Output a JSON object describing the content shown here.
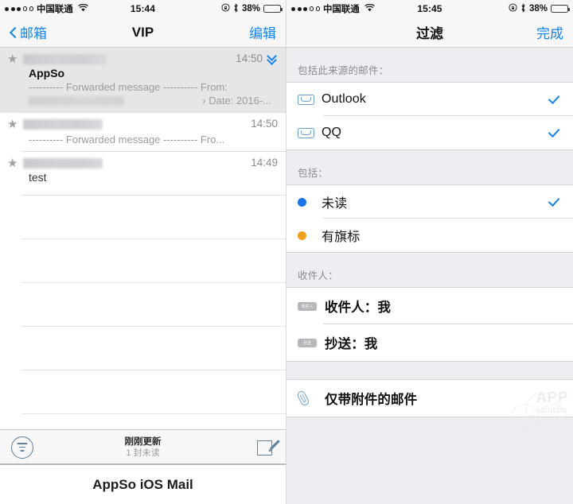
{
  "left": {
    "status": {
      "carrier": "中国联通",
      "time": "15:44",
      "battery_pct": "38%",
      "signal_dots_filled": 3,
      "signal_dots_total": 5
    },
    "nav": {
      "back_label": "邮箱",
      "title": "VIP",
      "right_label": "编辑"
    },
    "mails": [
      {
        "sender_blurred": true,
        "time": "14:50",
        "has_thread_chevron": true,
        "subject": "AppSo",
        "preview": "---------- Forwarded message ---------- From:",
        "preview2": "› Date: 2016-...",
        "selected": true
      },
      {
        "sender_blurred": true,
        "time": "14:50",
        "has_thread_chevron": false,
        "subject": "",
        "preview": "---------- Forwarded message ---------- Fro...",
        "preview2": "",
        "selected": false
      },
      {
        "sender_blurred": true,
        "time": "14:49",
        "has_thread_chevron": false,
        "subject": "test",
        "preview": "",
        "preview2": "",
        "selected": false
      }
    ],
    "toolbar": {
      "filter_icon": "filter-circle-icon",
      "updated_label": "刚刚更新",
      "unread_label": "1 封未读",
      "compose_icon": "compose-icon"
    },
    "caption": "AppSo iOS Mail"
  },
  "right": {
    "status": {
      "carrier": "中国联通",
      "time": "15:45",
      "battery_pct": "38%",
      "signal_dots_filled": 3,
      "signal_dots_total": 5
    },
    "nav": {
      "title": "过滤",
      "right_label": "完成"
    },
    "sections": [
      {
        "header": "包括此来源的邮件：",
        "rows": [
          {
            "icon": "inbox-icon",
            "label": "Outlook",
            "checked": true
          },
          {
            "icon": "inbox-icon",
            "label": "QQ",
            "checked": true
          }
        ]
      },
      {
        "header": "包括：",
        "rows": [
          {
            "icon": "blue-dot-icon",
            "dot_color": "#1a73e8",
            "label": "未读",
            "checked": true
          },
          {
            "icon": "orange-dot-icon",
            "dot_color": "#f0a020",
            "label": "有旗标",
            "checked": false
          }
        ]
      },
      {
        "header": "收件人：",
        "rows": [
          {
            "icon": "recipient-badge-icon",
            "badge": "收件人",
            "label": "收件人：我",
            "checked": false
          },
          {
            "icon": "cc-badge-icon",
            "badge": "抄送",
            "label": "抄送：我",
            "checked": false
          }
        ]
      },
      {
        "header": "",
        "rows": [
          {
            "icon": "paperclip-icon",
            "label": "仅带附件的邮件",
            "checked": false
          }
        ]
      }
    ],
    "watermark": {
      "line1": "APP",
      "line2": "solution"
    }
  },
  "colors": {
    "accent_blue": "#1783e8",
    "icon_blue": "#6a9fd0",
    "unread_dot": "#1a73e8",
    "flag_dot": "#f0a020",
    "panel_bg": "#eceef2",
    "bar_bg": "#f7f7f8"
  }
}
